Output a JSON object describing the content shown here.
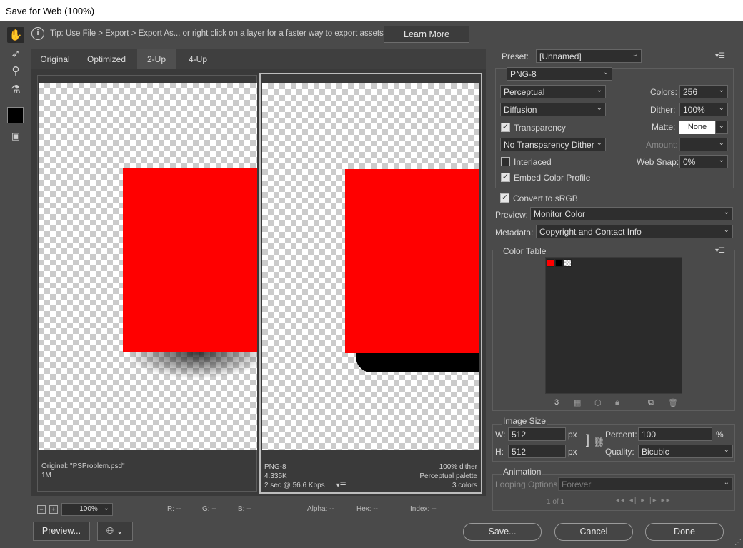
{
  "window": {
    "title": "Save for Web (100%)"
  },
  "tools": [
    {
      "name": "hand-tool",
      "glyph": "✋"
    },
    {
      "name": "slice-select-tool",
      "glyph": "➶"
    },
    {
      "name": "zoom-tool",
      "glyph": "⚲"
    },
    {
      "name": "eyedropper-tool",
      "glyph": "⚗"
    }
  ],
  "tip": {
    "text": "Tip: Use File > Export > Export As...  or right click on a layer for a faster way to export assets",
    "button": "Learn More"
  },
  "tabs": [
    "Original",
    "Optimized",
    "2-Up",
    "4-Up"
  ],
  "active_tab": "2-Up",
  "panes": {
    "left": {
      "line1": "Original: \"PSProblem.psd\"",
      "line2": "1M"
    },
    "right": {
      "line1": "PNG-8",
      "line2": "4.335K",
      "line3": "2 sec @ 56.6 Kbps",
      "rline1": "100% dither",
      "rline2": "Perceptual palette",
      "rline3": "3 colors"
    }
  },
  "status": {
    "zoom": "100%",
    "r": "R: --",
    "g": "G: --",
    "b": "B: --",
    "alpha": "Alpha: --",
    "hex": "Hex: --",
    "index": "Index: --"
  },
  "settings": {
    "preset_label": "Preset:",
    "preset_value": "[Unnamed]",
    "format": "PNG-8",
    "reduction": "Perceptual",
    "dither_algo": "Diffusion",
    "transparency_label": "Transparency",
    "transparency_dither": "No Transparency Dither",
    "interlaced_label": "Interlaced",
    "embed_label": "Embed Color Profile",
    "colors_label": "Colors:",
    "colors_value": "256",
    "dither_label": "Dither:",
    "dither_value": "100%",
    "matte_label": "Matte:",
    "matte_value": "None",
    "amount_label": "Amount:",
    "websnap_label": "Web Snap:",
    "websnap_value": "0%",
    "convert_label": "Convert to sRGB",
    "preview_label": "Preview:",
    "preview_value": "Monitor Color",
    "metadata_label": "Metadata:",
    "metadata_value": "Copyright and Contact Info"
  },
  "color_table": {
    "title": "Color Table",
    "count": "3",
    "swatches": [
      "#ff0000",
      "#000000",
      "checker"
    ]
  },
  "image_size": {
    "title": "Image Size",
    "w_label": "W:",
    "w_value": "512",
    "h_label": "H:",
    "h_value": "512",
    "unit": "px",
    "percent_label": "Percent:",
    "percent_value": "100",
    "percent_unit": "%",
    "quality_label": "Quality:",
    "quality_value": "Bicubic"
  },
  "animation": {
    "title": "Animation",
    "looping_label": "Looping Options:",
    "looping_value": "Forever",
    "frame": "1 of 1"
  },
  "buttons": {
    "preview": "Preview...",
    "save": "Save...",
    "cancel": "Cancel",
    "done": "Done"
  },
  "colors": {
    "accent_red": "#ff0000",
    "dialog_bg": "#4a4a4a",
    "panel_bg": "#2b2b2b"
  }
}
